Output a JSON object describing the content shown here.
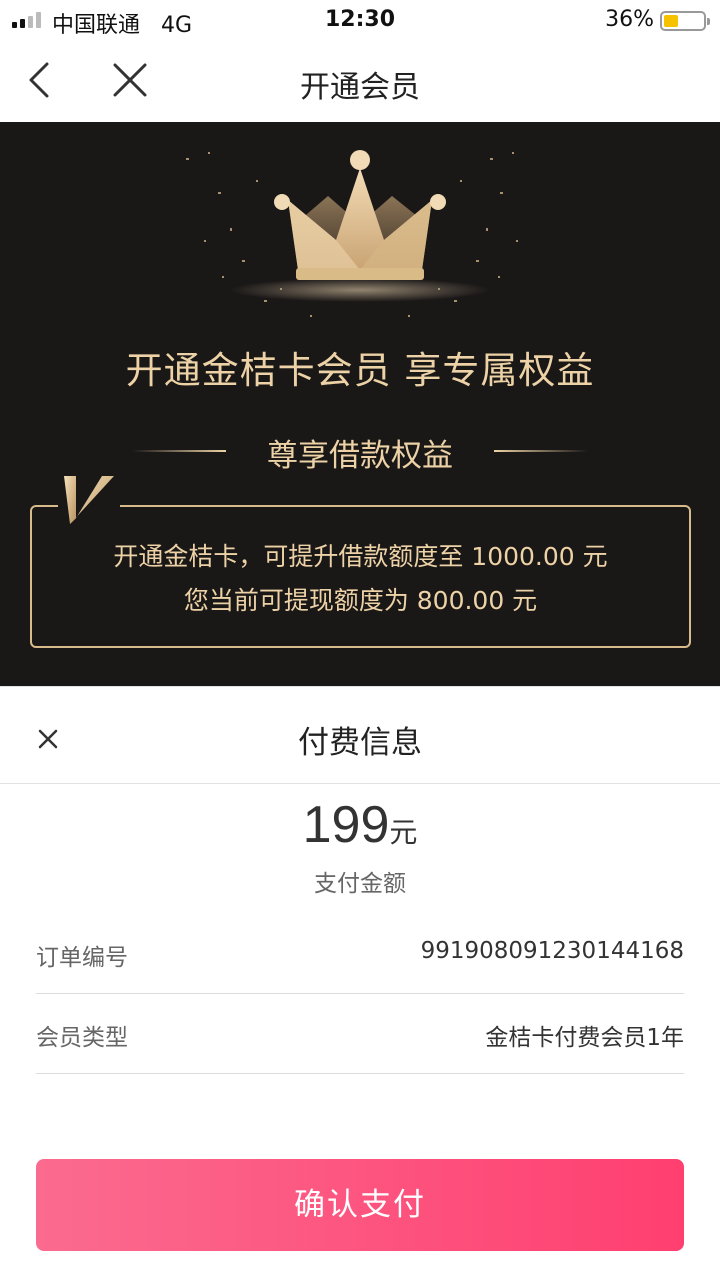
{
  "status_bar": {
    "carrier": "中国联通",
    "network": "4G",
    "time": "12:30",
    "battery_percent_text": "36%",
    "battery_level": 0.36,
    "battery_color": "#f6c200"
  },
  "nav": {
    "title": "开通会员",
    "back_icon": "chevron-left-icon",
    "close_icon": "close-icon"
  },
  "banner": {
    "headline": "开通金桔卡会员 享专属权益",
    "subheading": "尊享借款权益",
    "benefit_line_1": "开通金桔卡，可提升借款额度至 1000.00 元",
    "benefit_line_2": "您当前可提现额度为 800.00 元",
    "accent_color": "#ecd2a6",
    "background_color": "#1a1717",
    "crown_icon": "crown-icon",
    "badge_icon": "v-badge-icon"
  },
  "payment": {
    "title": "付费信息",
    "amount": "199",
    "amount_unit": "元",
    "amount_label": "支付金额",
    "rows": [
      {
        "label": "订单编号",
        "value": "991908091230144168"
      },
      {
        "label": "会员类型",
        "value": "金桔卡付费会员1年"
      }
    ],
    "confirm_label": "确认支付",
    "button_color": "#ff4f7b"
  }
}
